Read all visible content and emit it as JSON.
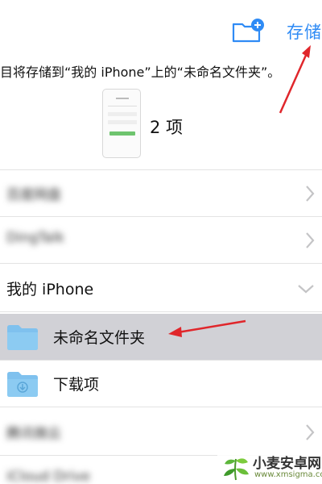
{
  "header": {
    "save_label": "存储",
    "new_folder_icon": "folder-add-icon"
  },
  "message": "目将存储到“我的 iPhone”上的“未命名文件夹”。",
  "preview": {
    "count_label": "2 项"
  },
  "list": {
    "rows": [
      {
        "label": "百度网盘",
        "blurred": true
      },
      {
        "label": "DingTalk",
        "blurred": true
      },
      {
        "label": "我的 iPhone"
      },
      {
        "label": "未命名文件夹",
        "selected": true
      },
      {
        "label": "下载项"
      },
      {
        "label": "腾讯微云",
        "blurred": true
      },
      {
        "label": "iCloud Drive",
        "blurred": true
      }
    ]
  },
  "watermark": {
    "brand": "小麦安卓网",
    "url": "www.xmsigma.com"
  },
  "colors": {
    "accent": "#2f8bf5",
    "folder": "#7fc1ee",
    "selected_bg": "#d1d1d6",
    "annotation": "#e0262b"
  }
}
